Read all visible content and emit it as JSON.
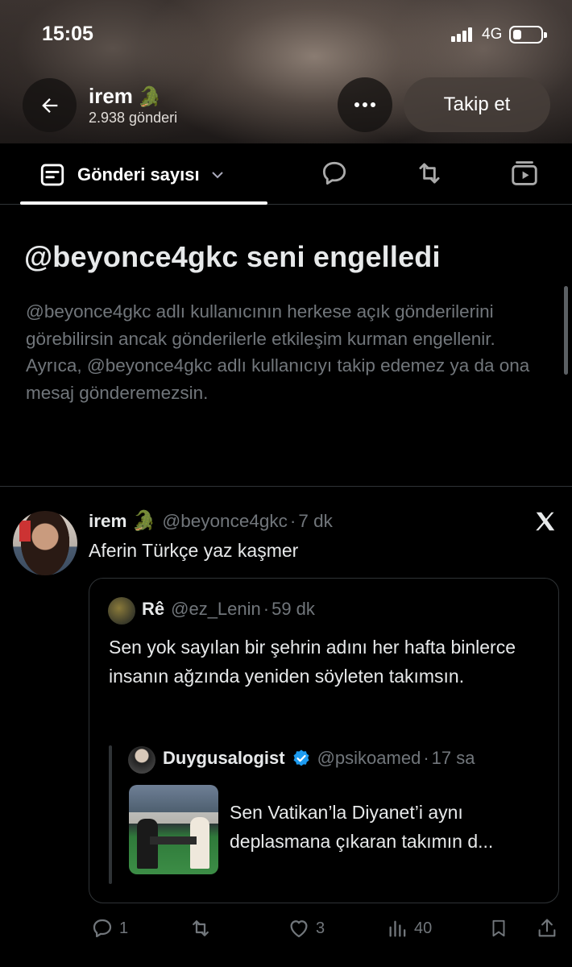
{
  "status_bar": {
    "time": "15:05",
    "network": "4G"
  },
  "header": {
    "name": "irem",
    "name_emoji": "🐊",
    "post_count": "2.938 gönderi",
    "follow_label": "Takip et"
  },
  "tabs": {
    "active_label": "Gönderi sayısı",
    "icons": [
      "posts-icon",
      "reply-icon",
      "repost-icon",
      "media-icon"
    ]
  },
  "blocked": {
    "title": "@beyonce4gkc seni engelledi",
    "body": "@beyonce4gkc adlı kullanıcının herkese açık gönderilerini görebilirsin ancak gönderilerle etkileşim kurman engellenir. Ayrıca, @beyonce4gkc adlı kullanıcıyı takip edemez ya da ona mesaj gönderemezsin."
  },
  "tweet": {
    "name": "irem",
    "emoji": "🐊",
    "handle": "@beyonce4gkc",
    "sep": "·",
    "time": "7 dk",
    "text": "Aferin Türkçe yaz kaşmer",
    "quote": {
      "name": "Rê",
      "handle": "@ez_Lenin",
      "sep": "·",
      "time": "59 dk",
      "text": "Sen yok sayılan bir şehrin adını her hafta binlerce insanın ağzında yeniden söyleten takımsın.",
      "nested": {
        "name": "Duygusalogist",
        "handle": "@psikoamed",
        "sep": "·",
        "time": "17 sa",
        "text": "Sen Vatikan’la Diyanet’i aynı deplasmana çıkaran takımın d..."
      }
    },
    "actions": {
      "replies": "1",
      "reposts": "",
      "likes": "3",
      "views": "40"
    }
  },
  "colors": {
    "background": "#000000",
    "text": "#e7e9ea",
    "muted": "#71767b",
    "border": "#2f3336",
    "verified": "#1d9bf0"
  }
}
